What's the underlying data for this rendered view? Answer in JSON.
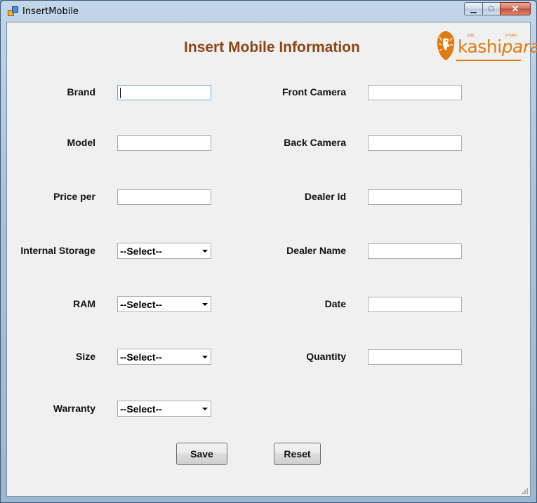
{
  "window": {
    "title": "InsertMobile",
    "controls": {
      "minimize": "▁",
      "maximize": "□",
      "close": "✕"
    }
  },
  "form": {
    "heading": "Insert Mobile Information",
    "logo": {
      "text_main": "kashi",
      "text_accent": "para",
      "tag_left": "[EB]",
      "tag_right": "[PORF]"
    },
    "left_fields": [
      {
        "label": "Brand",
        "type": "text",
        "value": ""
      },
      {
        "label": "Model",
        "type": "text",
        "value": ""
      },
      {
        "label": "Price per",
        "type": "text",
        "value": ""
      },
      {
        "label": "Internal Storage",
        "type": "select",
        "value": "--Select--"
      },
      {
        "label": "RAM",
        "type": "select",
        "value": "--Select--"
      },
      {
        "label": "Size",
        "type": "select",
        "value": "--Select--"
      },
      {
        "label": "Warranty",
        "type": "select",
        "value": "--Select--"
      }
    ],
    "right_fields": [
      {
        "label": "Front Camera",
        "type": "text",
        "value": ""
      },
      {
        "label": "Back Camera",
        "type": "text",
        "value": ""
      },
      {
        "label": "Dealer Id",
        "type": "text",
        "value": ""
      },
      {
        "label": "Dealer Name",
        "type": "text",
        "value": ""
      },
      {
        "label": "Date",
        "type": "text",
        "value": ""
      },
      {
        "label": "Quantity",
        "type": "text",
        "value": ""
      }
    ],
    "buttons": {
      "save": "Save",
      "reset": "Reset"
    }
  },
  "colors": {
    "heading": "#8b4513",
    "logo": "#e07b12"
  }
}
